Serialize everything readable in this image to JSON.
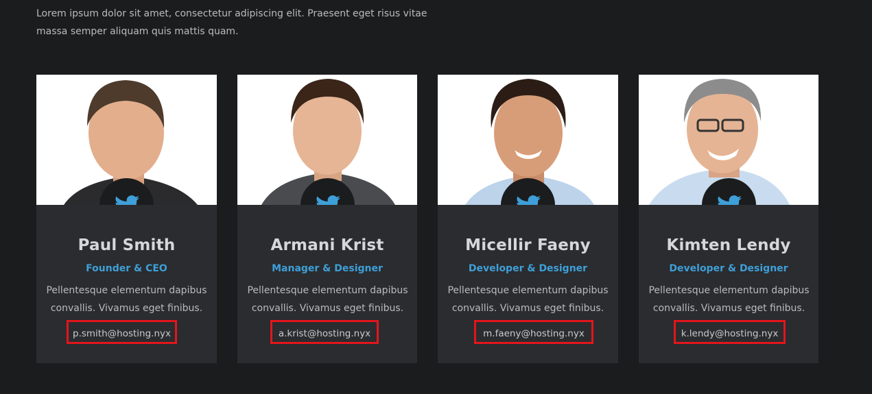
{
  "intro": {
    "text": "Lorem ipsum dolor sit amet, consectetur adipiscing elit. Praesent eget risus vitae massa semper aliquam quis mattis quam."
  },
  "colors": {
    "background": "#1b1c1e",
    "card": "#2a2c2f",
    "accent": "#3f9fd8",
    "highlight_border": "#e3151b"
  },
  "team": [
    {
      "name": "Paul Smith",
      "role": "Founder & CEO",
      "description": "Pellentesque elementum dapibus convallis. Vivamus eget finibus.",
      "email": "p.smith@hosting.nyx",
      "social_icon": "twitter-icon"
    },
    {
      "name": "Armani Krist",
      "role": "Manager & Designer",
      "description": "Pellentesque elementum dapibus convallis. Vivamus eget finibus.",
      "email": "a.krist@hosting.nyx",
      "social_icon": "twitter-icon"
    },
    {
      "name": "Micellir Faeny",
      "role": "Developer & Designer",
      "description": "Pellentesque elementum dapibus convallis. Vivamus eget finibus.",
      "email": "m.faeny@hosting.nyx",
      "social_icon": "twitter-icon"
    },
    {
      "name": "Kimten Lendy",
      "role": "Developer & Designer",
      "description": "Pellentesque elementum dapibus convallis. Vivamus eget finibus.",
      "email": "k.lendy@hosting.nyx",
      "social_icon": "twitter-icon"
    }
  ]
}
